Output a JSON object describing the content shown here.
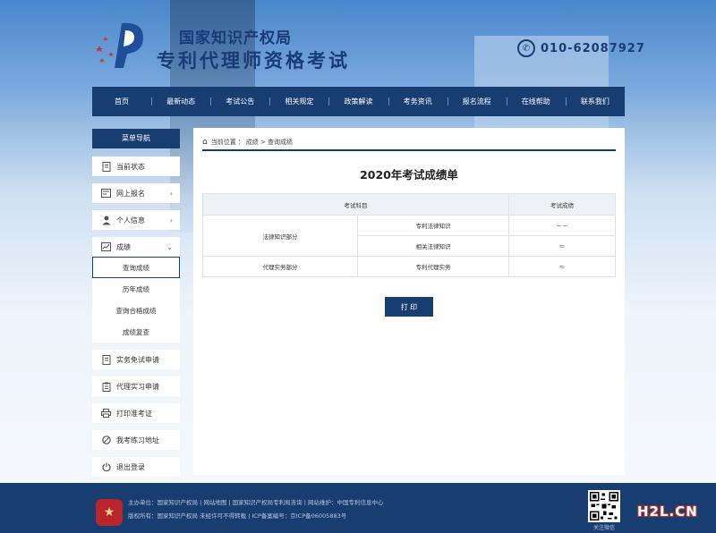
{
  "header": {
    "org_name": "国家知识产权局",
    "system_title": "专利代理师资格考试",
    "phone": "010-62087927"
  },
  "nav": {
    "items": [
      "首页",
      "最新动态",
      "考试公告",
      "相关规定",
      "政策解读",
      "考务资讯",
      "报名流程",
      "在线帮助",
      "联系我们"
    ]
  },
  "sidebar": {
    "header": "菜单导航",
    "items": [
      {
        "label": "当前状态",
        "icon": "document-icon"
      },
      {
        "label": "网上报名",
        "icon": "form-icon"
      },
      {
        "label": "个人信息",
        "icon": "user-icon"
      },
      {
        "label": "成绩",
        "icon": "chart-icon"
      }
    ],
    "score_subitems": [
      "查询成绩",
      "历年成绩",
      "查询合格成绩",
      "成绩复查"
    ],
    "bottom_items": [
      {
        "label": "实务免试申请",
        "icon": "document-icon"
      },
      {
        "label": "代理实习申请",
        "icon": "clipboard-icon"
      },
      {
        "label": "打印准考证",
        "icon": "printer-icon"
      },
      {
        "label": "我考练习地址",
        "icon": "no-icon"
      },
      {
        "label": "退出登录",
        "icon": "power-icon"
      }
    ]
  },
  "main": {
    "breadcrumb": {
      "home": "当前位置",
      "path": "成绩 > 查询成绩"
    },
    "title": "2020年考试成绩单",
    "table": {
      "headers": [
        "考试科目",
        "考试成绩"
      ],
      "group1_name": "法律知识部分",
      "rows": [
        {
          "subject": "专利法律知识",
          "score": "~~"
        },
        {
          "subject": "相关法律知识",
          "score": "≈"
        }
      ],
      "group2_name": "代理实务部分",
      "row3": {
        "subject": "专利代理实务",
        "score": "≈"
      }
    },
    "print_button": "打 印"
  },
  "footer": {
    "line1": "主办单位：国家知识产权局 | 网站地图 | 国家知识产权局专利局咨询 | 网站维护：中国专利信息中心",
    "line2": "版权所有：国家知识产权局  未经许可不得转载  |  ICP备案编号：京ICP备06005883号",
    "qr_label": "关注微信",
    "watermark": "H2L.CN"
  }
}
